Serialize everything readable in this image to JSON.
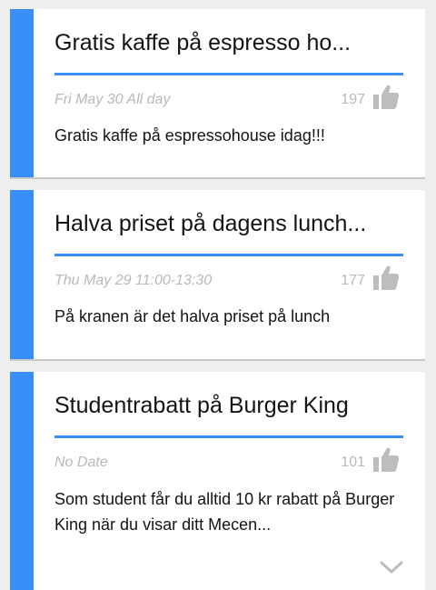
{
  "cards": [
    {
      "title": "Gratis kaffe på espresso ho...",
      "date": "Fri May 30 All day",
      "likes": "197",
      "body": "Gratis kaffe på espressohouse idag!!!"
    },
    {
      "title": "Halva priset på dagens lunch...",
      "date": "Thu May 29 11:00-13:30",
      "likes": "177",
      "body": "På kranen är det halva priset på lunch"
    },
    {
      "title": "Studentrabatt på Burger King",
      "date": "No Date",
      "likes": "101",
      "body": "Som student får du alltid 10 kr rabatt på Burger King när du visar ditt Mecen..."
    }
  ],
  "icons": {
    "like": "thumbs-up-icon",
    "expand": "chevron-down-icon"
  },
  "colors": {
    "accent": "#3a8ef7",
    "muted_text": "#b9b9b9",
    "icon_gray": "#bdbdbd",
    "background": "#eeeeee"
  }
}
